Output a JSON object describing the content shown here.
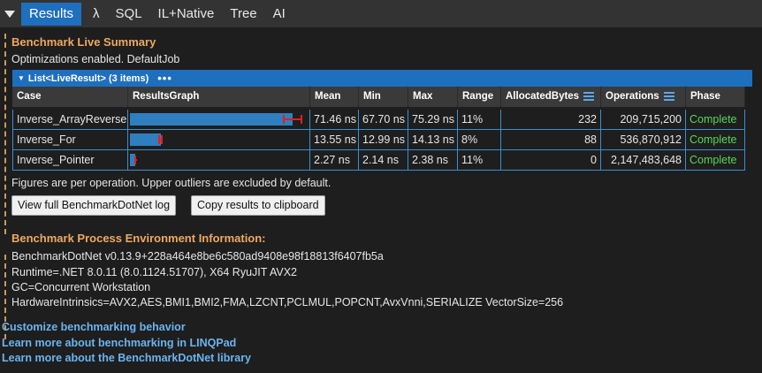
{
  "tabs": {
    "items": [
      {
        "label": "Results",
        "active": true
      },
      {
        "label": "λ"
      },
      {
        "label": "SQL"
      },
      {
        "label": "IL+Native"
      },
      {
        "label": "Tree"
      },
      {
        "label": "AI"
      }
    ]
  },
  "summary": {
    "heading": "Benchmark Live Summary",
    "subtitle": "Optimizations enabled.  DefaultJob",
    "list_header": "List<LiveResult> (3 items)",
    "list_menu": "•••",
    "columns": [
      "Case",
      "ResultsGraph",
      "Mean",
      "Min",
      "Max",
      "Range",
      "AllocatedBytes",
      "Operations",
      "Phase"
    ],
    "rows": [
      {
        "case": "Inverse_ArrayReverse",
        "mean": "71.46 ns",
        "min": "67.70 ns",
        "max": "75.29 ns",
        "range": "11%",
        "allocated": "232",
        "operations": "209,715,200",
        "phase": "Complete",
        "mean_val": 71.46,
        "min_val": 67.7,
        "max_val": 75.29
      },
      {
        "case": "Inverse_For",
        "mean": "13.55 ns",
        "min": "12.99 ns",
        "max": "14.13 ns",
        "range": "8%",
        "allocated": "88",
        "operations": "536,870,912",
        "phase": "Complete",
        "mean_val": 13.55,
        "min_val": 12.99,
        "max_val": 14.13
      },
      {
        "case": "Inverse_Pointer",
        "mean": "2.27 ns",
        "min": "2.14 ns",
        "max": "2.38 ns",
        "range": "11%",
        "allocated": "0",
        "operations": "2,147,483,648",
        "phase": "Complete",
        "mean_val": 2.27,
        "min_val": 2.14,
        "max_val": 2.38
      }
    ],
    "footnote": "Figures are per operation. Upper outliers are excluded by default.",
    "btn_view_log": "View full BenchmarkDotNet log",
    "btn_copy": "Copy results to clipboard"
  },
  "environment": {
    "heading": "Benchmark Process Environment Information:",
    "lines": [
      "BenchmarkDotNet v0.13.9+228a464e8be6c580ad9408e98f18813f6407fb5a",
      "Runtime=.NET 8.0.11 (8.0.1124.51707), X64 RyuJIT AVX2",
      "GC=Concurrent Workstation",
      "HardwareIntrinsics=AVX2,AES,BMI1,BMI2,FMA,LZCNT,PCLMUL,POPCNT,AvxVnni,SERIALIZE VectorSize=256"
    ]
  },
  "links": [
    "Customize benchmarking behavior",
    "Learn more about benchmarking in LINQPad",
    "Learn more about the BenchmarkDotNet library"
  ],
  "colors": {
    "accent": "#1f6fbf",
    "heading": "#f0a860",
    "phase_complete": "#57d65a",
    "link": "#6ab4f0",
    "error_bar": "#e02020"
  }
}
